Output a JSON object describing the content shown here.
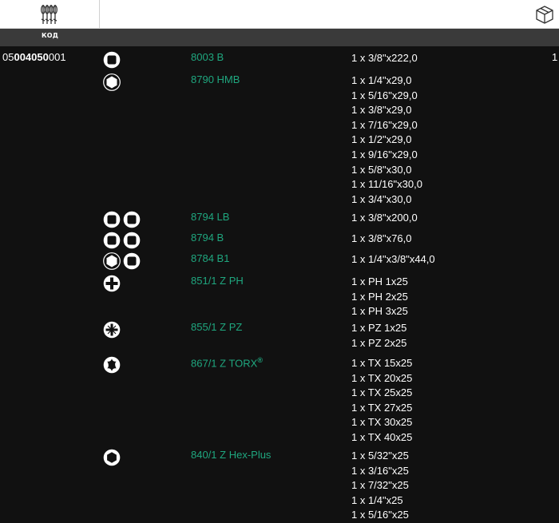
{
  "header": {
    "code_label": "КОД",
    "tools_icon": "screwdriver-set-icon",
    "box_icon": "package-box-icon"
  },
  "part": {
    "number_prefix": "05",
    "number_bold": "004050",
    "number_suffix": "001",
    "quantity": "1"
  },
  "groups": [
    {
      "model": "8003 B",
      "icons": [
        "square-drive-icon"
      ],
      "items": [
        "1 x 3/8\"x222,0"
      ]
    },
    {
      "model": "8790 HMB",
      "icons": [
        "hex-socket-icon"
      ],
      "items": [
        "1 x 1/4\"x29,0",
        "1 x 5/16\"x29,0",
        "1 x 3/8\"x29,0",
        "1 x 7/16\"x29,0",
        "1 x 1/2\"x29,0",
        "1 x 9/16\"x29,0",
        "1 x 5/8\"x30,0",
        "1 x 11/16\"x30,0",
        "1 x 3/4\"x30,0"
      ]
    },
    {
      "model": "8794 LB",
      "icons": [
        "square-drive-icon",
        "square-drive-icon"
      ],
      "items": [
        "1 x 3/8\"x200,0"
      ]
    },
    {
      "model": "8794 B",
      "icons": [
        "square-drive-icon",
        "square-drive-icon"
      ],
      "items": [
        "1 x 3/8\"x76,0"
      ]
    },
    {
      "model": "8784 B1",
      "icons": [
        "hex-socket-icon",
        "square-drive-icon"
      ],
      "items": [
        "1 x 1/4\"x3/8\"x44,0"
      ]
    },
    {
      "model": "851/1 Z PH",
      "icons": [
        "phillips-icon"
      ],
      "items": [
        "1 x PH 1x25",
        "1 x PH 2x25",
        "1 x PH 3x25"
      ]
    },
    {
      "model": "855/1 Z PZ",
      "icons": [
        "pozidriv-icon"
      ],
      "items": [
        "1 x PZ 1x25",
        "1 x PZ 2x25"
      ]
    },
    {
      "model": "867/1 Z TORX",
      "model_sup": "®",
      "icons": [
        "torx-icon"
      ],
      "items": [
        "1 x TX 15x25",
        "1 x TX 20x25",
        "1 x TX 25x25",
        "1 x TX 27x25",
        "1 x TX 30x25",
        "1 x TX 40x25"
      ]
    },
    {
      "model": "840/1 Z Hex-Plus",
      "icons": [
        "hex-plus-icon"
      ],
      "items": [
        "1 x 5/32\"x25",
        "1 x 3/16\"x25",
        "1 x 7/32\"x25",
        "1 x 1/4\"x25",
        "1 x 5/16\"x25"
      ]
    }
  ],
  "colors": {
    "background": "#111111",
    "model_text": "#1fa77f",
    "label_bar": "#3a3a3a"
  }
}
